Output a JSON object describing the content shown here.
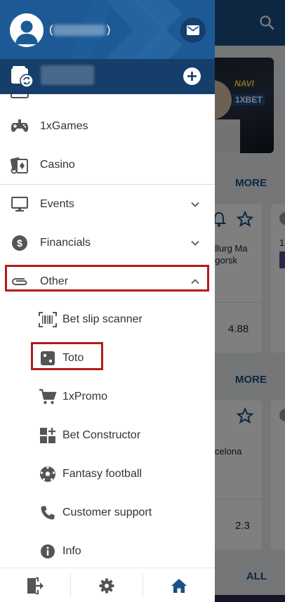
{
  "menu": {
    "items": [
      {
        "label": "1xGames",
        "icon": "gamepad-icon"
      },
      {
        "label": "Casino",
        "icon": "casino-icon"
      },
      {
        "label": "Events",
        "icon": "monitor-icon"
      },
      {
        "label": "Financials",
        "icon": "dollar-icon"
      },
      {
        "label": "Other",
        "icon": "paperclip-icon"
      }
    ],
    "other_subitems": [
      {
        "label": "Bet slip scanner",
        "icon": "barcode-icon"
      },
      {
        "label": "Toto",
        "icon": "dice-icon"
      },
      {
        "label": "1xPromo",
        "icon": "cart-icon"
      },
      {
        "label": "Bet Constructor",
        "icon": "constructor-icon"
      },
      {
        "label": "Fantasy football",
        "icon": "football-icon"
      },
      {
        "label": "Customer support",
        "icon": "phone-icon"
      },
      {
        "label": "Info",
        "icon": "info-icon"
      }
    ],
    "expanded_section": "Other"
  },
  "background": {
    "more_top": "MORE",
    "more_mid": "MORE",
    "all": "ALL",
    "banner_logo_1": "NAVI",
    "banner_logo_2": "1XBET",
    "card1_team": "allurg Ma",
    "card1_team2": "ogorsk",
    "card1_odd": "4.88",
    "card1_num": "1",
    "card2_team": "celona",
    "card2_odd": "2.3"
  },
  "colors": {
    "header_blue": "#1d5a95",
    "balance_blue": "#153f6a",
    "highlight_red": "#b31b1b",
    "accent_blue": "#1b4f86"
  }
}
